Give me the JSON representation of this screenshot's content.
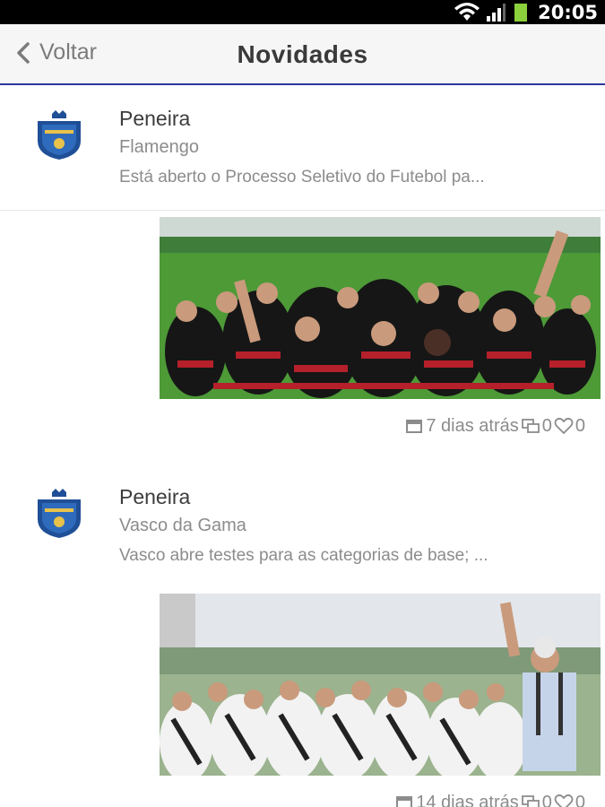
{
  "status_bar": {
    "time": "20:05"
  },
  "header": {
    "back_label": "Voltar",
    "title": "Novidades"
  },
  "posts": [
    {
      "title": "Peneira",
      "source": "Flamengo",
      "excerpt": "Está aberto o Processo Seletivo do Futebol pa...",
      "date": "7 dias atrás",
      "comments": "0",
      "likes": "0"
    },
    {
      "title": "Peneira",
      "source": "Vasco da Gama",
      "excerpt": "Vasco abre testes para as categorias de base; ...",
      "date": "14 dias atrás",
      "comments": "0",
      "likes": "0"
    }
  ],
  "colors": {
    "header_border": "#2b3a9e",
    "crest_blue": "#1f4f96",
    "muted_text": "#8c8c8c"
  }
}
